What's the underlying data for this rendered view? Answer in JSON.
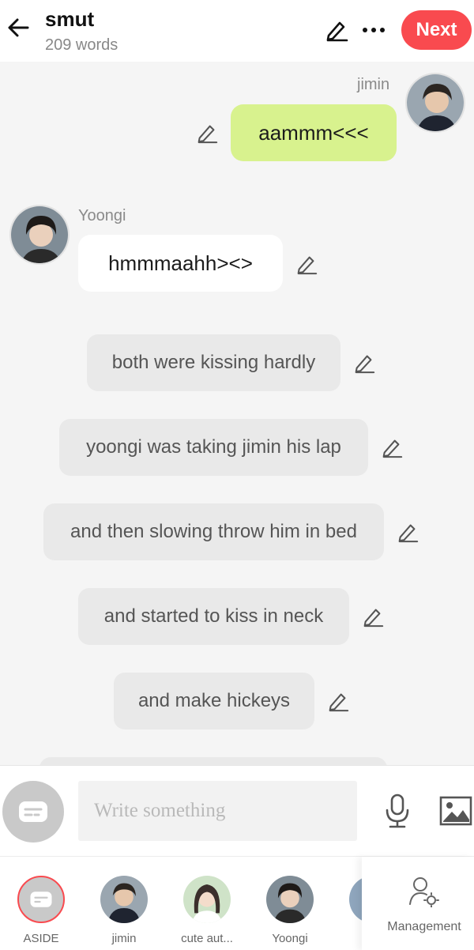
{
  "header": {
    "title": "smut",
    "word_count": "209 words",
    "next_label": "Next",
    "accent": "#f94a4f"
  },
  "messages": [
    {
      "type": "dialogue",
      "speaker": "jimin",
      "text": "aammm<<<",
      "side": "right",
      "bubble_color": "#d8f28e"
    },
    {
      "type": "dialogue",
      "speaker": "Yoongi",
      "text": "hmmmaahh><>",
      "side": "left",
      "bubble_color": "#ffffff"
    },
    {
      "type": "aside",
      "text": "both were kissing hardly"
    },
    {
      "type": "aside",
      "text": "yoongi was taking jimin his lap"
    },
    {
      "type": "aside",
      "text": "and then slowing throw him in bed"
    },
    {
      "type": "aside",
      "text": "and started to kiss in neck"
    },
    {
      "type": "aside",
      "text": "and make hickeys"
    }
  ],
  "composer": {
    "placeholder": "Write something"
  },
  "bottom_bar": {
    "characters": [
      {
        "label": "ASIDE",
        "selected": true
      },
      {
        "label": "jimin"
      },
      {
        "label": "cute aut..."
      },
      {
        "label": "Yoongi"
      }
    ],
    "management_label": "Management"
  },
  "icons": {
    "back": "arrow-left-icon",
    "edit": "pencil-icon",
    "more": "more-dots-icon",
    "mic": "microphone-icon",
    "image": "image-icon",
    "aside": "chat-bubble-icon",
    "management": "user-gear-icon"
  }
}
